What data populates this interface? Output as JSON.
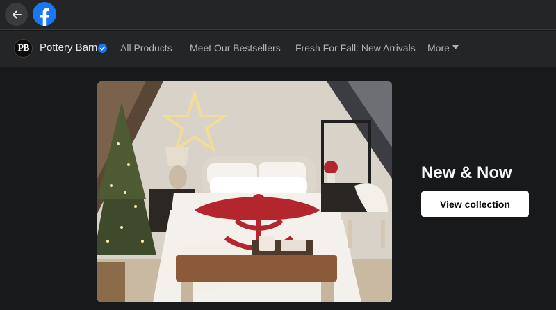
{
  "topbar": {
    "back_icon": "arrow-left-icon",
    "logo": "facebook-logo-icon"
  },
  "brand": {
    "initials": "PB",
    "name": "Pottery Barn",
    "verified_icon": "verified-badge-icon"
  },
  "nav": {
    "items": [
      {
        "label": "All Products"
      },
      {
        "label": "Meet Our Bestsellers"
      },
      {
        "label": "Fresh For Fall: New Arrivals"
      },
      {
        "label": "More"
      }
    ],
    "more_icon": "caret-down-icon"
  },
  "hero": {
    "title": "New & Now",
    "cta_label": "View collection"
  },
  "colors": {
    "background": "#18191a",
    "bar": "#242526",
    "facebook_blue": "#1877f2",
    "quilt_red": "#b3262e"
  }
}
